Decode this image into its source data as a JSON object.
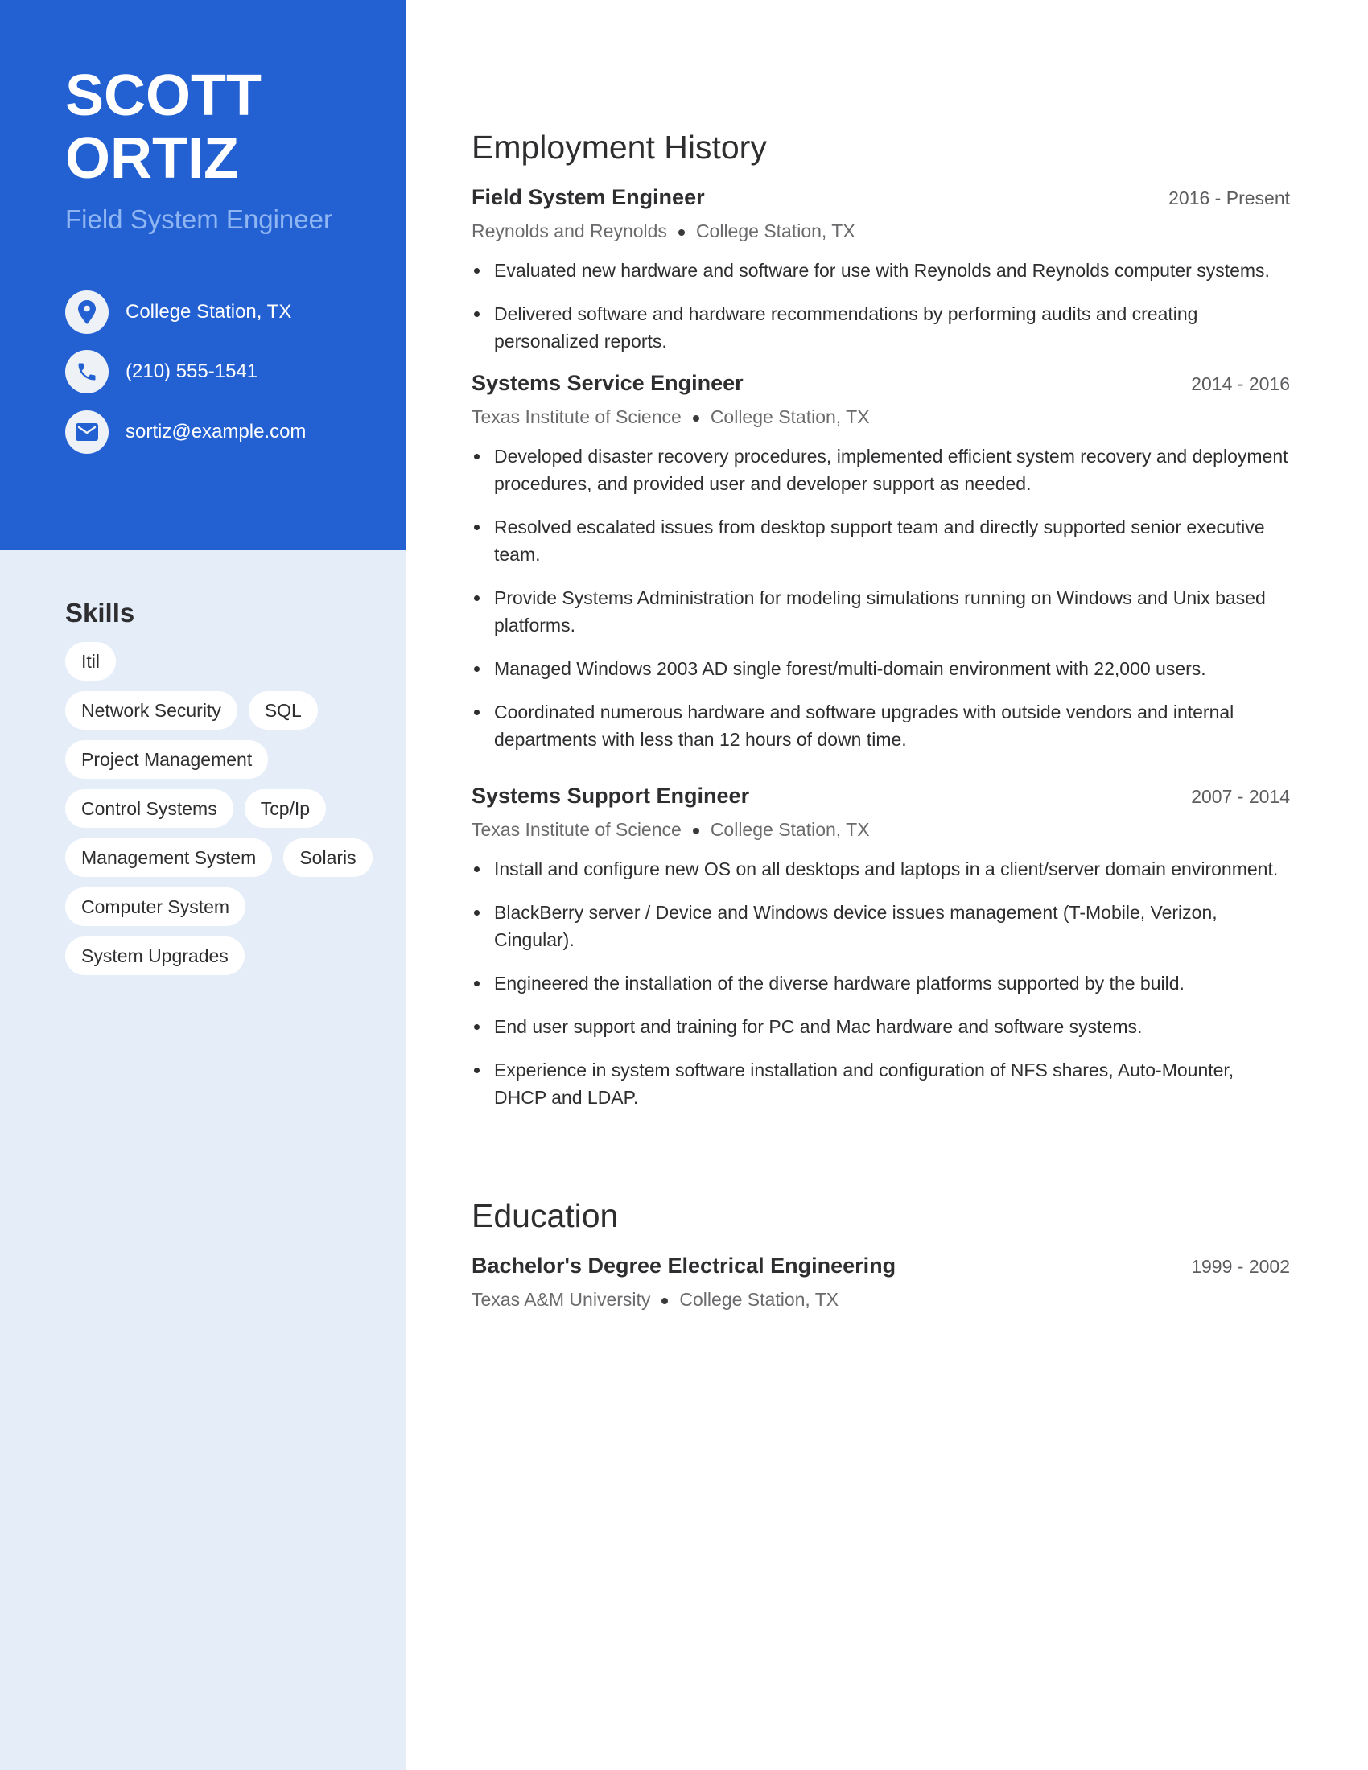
{
  "sidebar": {
    "name_line1": "SCOTT",
    "name_line2": "ORTIZ",
    "title": "Field System Engineer",
    "contacts": [
      {
        "icon": "location-pin-icon",
        "text": "College Station, TX"
      },
      {
        "icon": "phone-icon",
        "text": "(210) 555-1541"
      },
      {
        "icon": "envelope-icon",
        "text": "sortiz@example.com"
      }
    ],
    "skills_title": "Skills",
    "skills": [
      "Itil",
      "Network Security",
      "SQL",
      "Project Management",
      "Control Systems",
      "Tcp/Ip",
      "Management System",
      "Solaris",
      "Computer System",
      "System Upgrades"
    ]
  },
  "colors": {
    "accent_blue": "#2361d3",
    "sidebar_light": "#e5edf9",
    "title_light_blue": "#8fb6f2"
  },
  "employment": {
    "heading": "Employment History",
    "jobs": [
      {
        "title": "Field System Engineer",
        "dates": "2016 - Present",
        "company": "Reynolds and Reynolds",
        "location": "College Station, TX",
        "bullets": [
          "Evaluated new hardware and software for use with Reynolds and Reynolds computer systems.",
          "Delivered software and hardware recommendations by performing audits and creating personalized reports."
        ]
      },
      {
        "title": "Systems Service Engineer",
        "dates": "2014 - 2016",
        "company": "Texas Institute of Science",
        "location": "College Station, TX",
        "bullets": [
          "Developed disaster recovery procedures, implemented efficient system recovery and deployment procedures, and provided user and developer support as needed.",
          "Resolved escalated issues from desktop support team and directly supported senior executive team.",
          "Provide Systems Administration for modeling simulations running on Windows and Unix based platforms.",
          "Managed Windows 2003 AD single forest/multi-domain environment with 22,000 users.",
          "Coordinated numerous hardware and software upgrades with outside vendors and internal departments with less than 12 hours of down time."
        ]
      },
      {
        "title": "Systems Support Engineer",
        "dates": "2007 - 2014",
        "company": "Texas Institute of Science",
        "location": "College Station, TX",
        "bullets": [
          "Install and configure new OS on all desktops and laptops in a client/server domain environment.",
          "BlackBerry server / Device and Windows device issues management (T-Mobile, Verizon, Cingular).",
          "Engineered the installation of the diverse hardware platforms supported by the build.",
          "End user support and training for PC and Mac hardware and software systems.",
          "Experience in system software installation and configuration of NFS shares, Auto-Mounter, DHCP and LDAP."
        ]
      }
    ]
  },
  "education": {
    "heading": "Education",
    "items": [
      {
        "degree": "Bachelor's Degree Electrical Engineering",
        "dates": "1999 - 2002",
        "school": "Texas A&M University",
        "location": "College Station, TX"
      }
    ]
  }
}
